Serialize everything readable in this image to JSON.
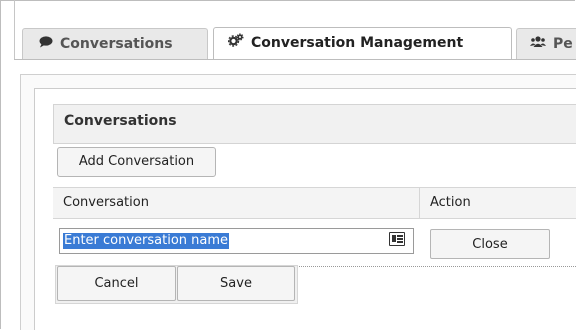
{
  "tabs": [
    {
      "label": "Conversations",
      "icon": "comment-icon",
      "active": false
    },
    {
      "label": "Conversation Management",
      "icon": "cogs-icon",
      "active": true
    },
    {
      "label": "Pe",
      "icon": "users-icon",
      "active": false
    }
  ],
  "panel": {
    "title": "Conversations",
    "add_button_label": "Add Conversation"
  },
  "grid": {
    "columns": [
      "Conversation",
      "Action"
    ],
    "edit_row": {
      "input_value": "Enter conversation name",
      "input_icon": "contact-card-icon",
      "close_label": "Close"
    }
  },
  "actions": {
    "cancel_label": "Cancel",
    "save_label": "Save"
  },
  "colors": {
    "selection": "#3a7bd5",
    "active_tab": "#ffffff",
    "inactive_tab": "#e9e9e9"
  }
}
